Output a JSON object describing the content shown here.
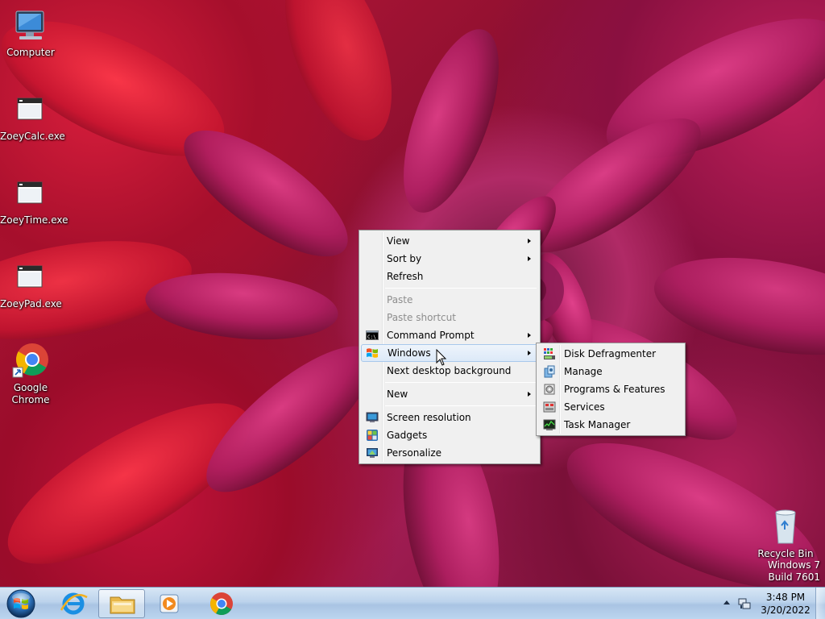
{
  "desktop": {
    "icons": [
      {
        "label": "Computer"
      },
      {
        "label": "ZoeyCalc.exe"
      },
      {
        "label": "ZoeyTime.exe"
      },
      {
        "label": "ZoeyPad.exe"
      },
      {
        "label": "Google Chrome"
      },
      {
        "label": "Recycle Bin"
      }
    ],
    "watermark": {
      "line1": "Windows 7",
      "line2": "Build 7601"
    }
  },
  "context_menu": {
    "items": [
      {
        "label": "View",
        "submenu": true
      },
      {
        "label": "Sort by",
        "submenu": true
      },
      {
        "label": "Refresh"
      },
      {
        "label": "Paste",
        "disabled": true
      },
      {
        "label": "Paste shortcut",
        "disabled": true
      },
      {
        "label": "Command Prompt",
        "submenu": true,
        "icon": "cmd-icon"
      },
      {
        "label": "Windows",
        "submenu": true,
        "icon": "windows-flag-icon",
        "highlighted": true
      },
      {
        "label": "Next desktop background"
      },
      {
        "label": "New",
        "submenu": true
      },
      {
        "label": "Screen resolution",
        "icon": "monitor-icon"
      },
      {
        "label": "Gadgets",
        "icon": "gadgets-icon"
      },
      {
        "label": "Personalize",
        "icon": "personalize-icon"
      }
    ]
  },
  "submenu": {
    "items": [
      {
        "label": "Disk Defragmenter",
        "icon": "defrag-icon"
      },
      {
        "label": "Manage",
        "icon": "manage-icon"
      },
      {
        "label": "Programs & Features",
        "icon": "programs-icon"
      },
      {
        "label": "Services",
        "icon": "services-icon"
      },
      {
        "label": "Task Manager",
        "icon": "task-manager-icon"
      }
    ]
  },
  "taskbar": {
    "pinned": [
      "internet-explorer-icon",
      "file-explorer-icon",
      "media-player-icon",
      "chrome-icon"
    ],
    "clock": {
      "time": "3:48 PM",
      "date": "3/20/2022"
    }
  },
  "colors": {
    "highlight_border": "#a8c8ec",
    "menu_bg": "#f0f0f0",
    "taskbar": "#bcd3ec"
  }
}
